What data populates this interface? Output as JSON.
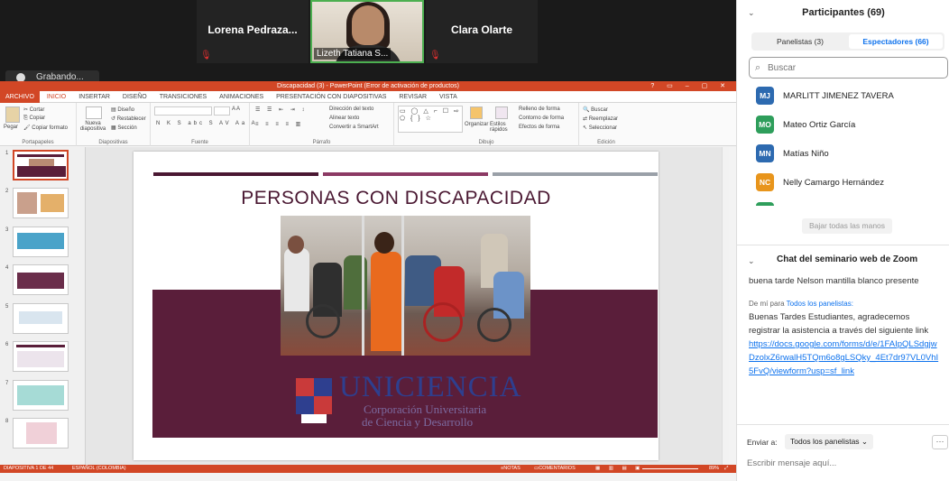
{
  "video": {
    "tile_left_name": "Lorena  Pedraza...",
    "tile_center_name": "Lizeth Tatiana S...",
    "tile_right_name": "Clara Olarte",
    "recording": "Grabando..."
  },
  "ppt": {
    "window_title": "Discapacidad (3)  -  PowerPoint (Error de activación de productos)",
    "tabs": [
      "ARCHIVO",
      "INICIO",
      "INSERTAR",
      "DISEÑO",
      "TRANSICIONES",
      "ANIMACIONES",
      "PRESENTACIÓN CON DIAPOSITIVAS",
      "REVISAR",
      "VISTA"
    ],
    "ribbon": {
      "paste": "Pegar",
      "cut": "Cortar",
      "copy": "Copiar",
      "format_painter": "Copiar formato",
      "group_clipboard": "Portapapeles",
      "new_slide": "Nueva diapositiva",
      "layout": "Diseño",
      "reset": "Restablecer",
      "section": "Sección",
      "group_slides": "Diapositivas",
      "group_font": "Fuente",
      "text_direction": "Dirección del texto",
      "align_text": "Alinear texto",
      "smartart": "Convertir a SmartArt",
      "group_paragraph": "Párrafo",
      "arrange": "Organizar",
      "quick_styles": "Estilos rápidos",
      "shape_fill": "Relleno de forma",
      "shape_outline": "Contorno de forma",
      "shape_effects": "Efectos de forma",
      "group_drawing": "Dibujo",
      "find": "Buscar",
      "replace": "Reemplazar",
      "select": "Seleccionar",
      "group_editing": "Edición"
    },
    "slide_numbers": [
      "1",
      "2",
      "3",
      "4",
      "5",
      "6",
      "7",
      "8"
    ],
    "slide": {
      "title": "PERSONAS CON DISCAPACIDAD",
      "logo_word": "UNICIENCIA",
      "logo_sub1": "Corporación Universitaria",
      "logo_sub2": "de Ciencia y Desarrollo"
    },
    "status": {
      "slide_count": "DIAPOSITIVA 1 DE 44",
      "language": "ESPAÑOL (COLOMBIA)",
      "notes": "NOTAS",
      "comments": "COMENTARIOS",
      "zoom": "89%"
    }
  },
  "colors": {
    "ppt_accent": "#d24726",
    "slide_band": "#5a1e3a",
    "zoom_blue": "#0e72ed"
  },
  "zoom": {
    "participants_title": "Participantes (69)",
    "tab_panelists": "Panelistas (3)",
    "tab_attendees": "Espectadores (66)",
    "search_placeholder": "Buscar",
    "participants": [
      {
        "initials": "MJ",
        "name": "MARLITT JIMENEZ TAVERA",
        "color": "#2d6ab0"
      },
      {
        "initials": "MO",
        "name": "Mateo Ortiz García",
        "color": "#2e9e5b"
      },
      {
        "initials": "MN",
        "name": "Matías Niño",
        "color": "#2d6ab0"
      },
      {
        "initials": "NC",
        "name": "Nelly Camargo Hernández",
        "color": "#e8951c"
      }
    ],
    "lower_hands": "Bajar todas las manos",
    "chat_title": "Chat del seminario web de Zoom",
    "chat_msg1": "buena tarde Nelson mantilla blanco presente",
    "chat_meta_prefix": "De mí para",
    "chat_meta_to": "Todos los panelistas:",
    "chat_msg2": "Buenas Tardes Estudiantes, agradecemos registrar la asistencia a través del siguiente link",
    "chat_link": "https://docs.google.com/forms/d/e/1FAIpQLSdgjwDzolxZ6rwalH5TQm6o8gLSQky_4Et7dr97VL0VhI5FvQ/viewform?usp=sf_link",
    "send_to_label": "Enviar a:",
    "send_to_value": "Todos los panelistas",
    "message_placeholder": "Escribir mensaje aquí..."
  }
}
